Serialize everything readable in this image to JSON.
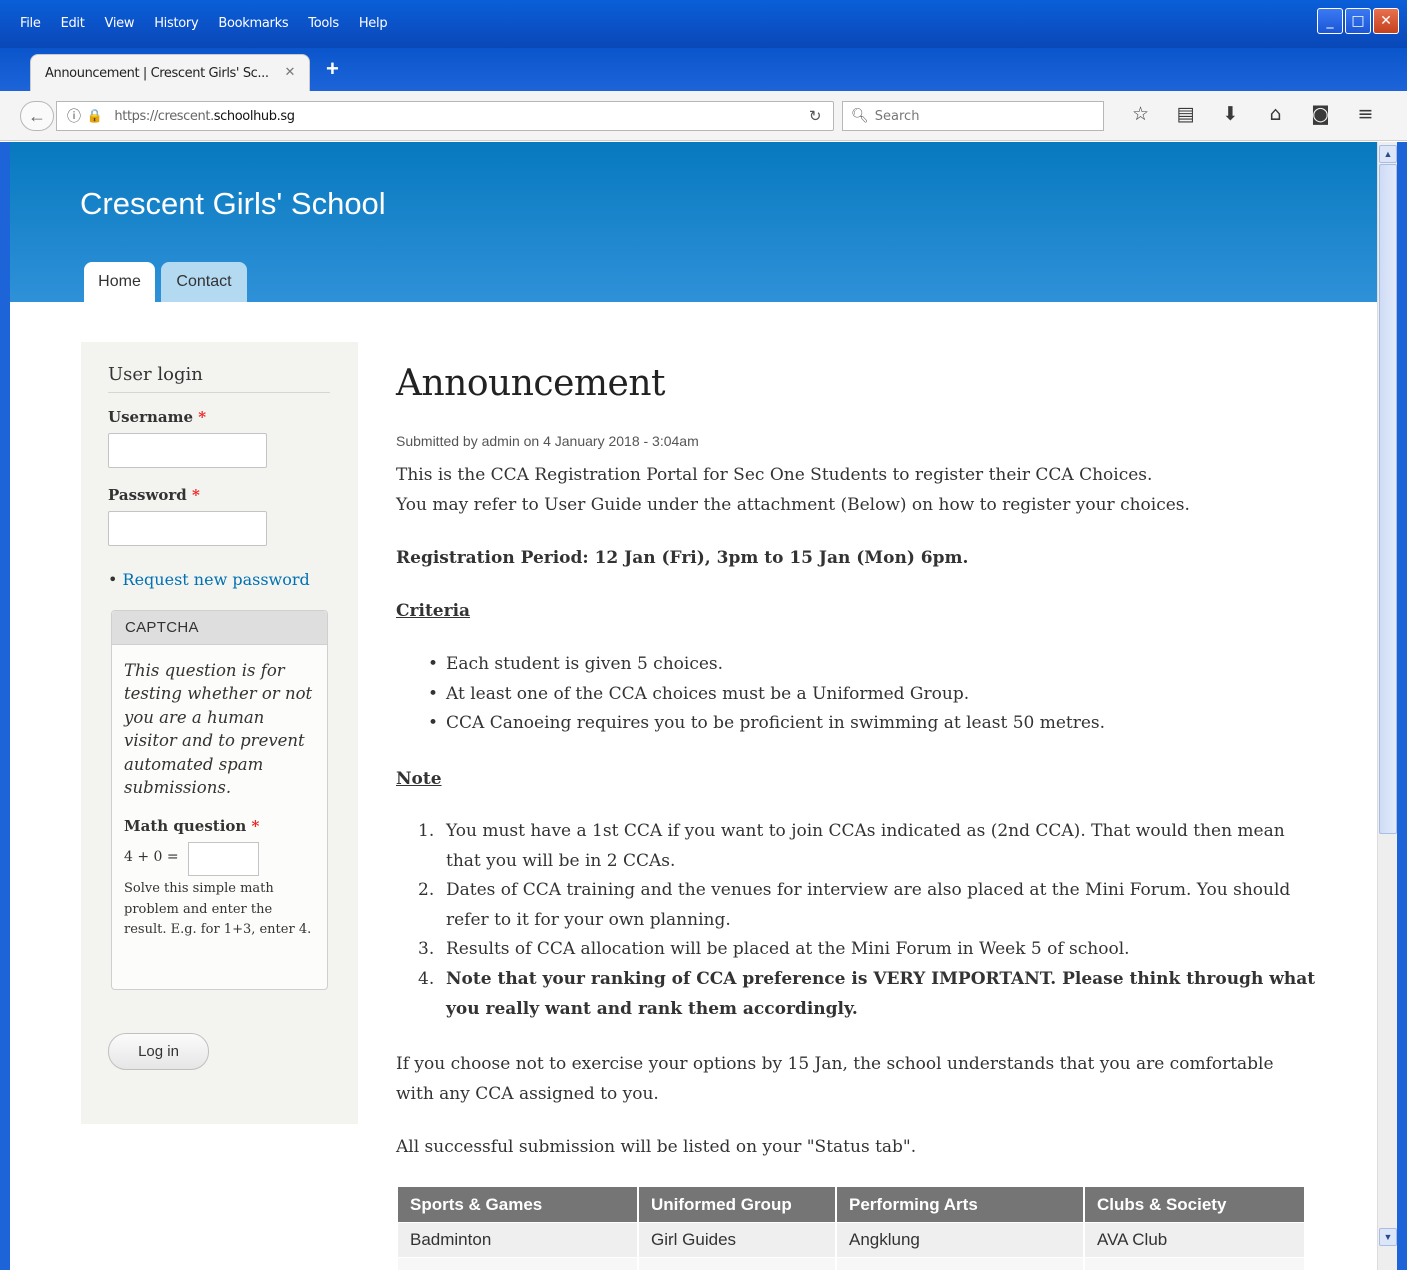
{
  "browser": {
    "menu": [
      "File",
      "Edit",
      "View",
      "History",
      "Bookmarks",
      "Tools",
      "Help"
    ],
    "tab_title": "Announcement | Crescent Girls' Sc...",
    "tab_close": "✕",
    "new_tab": "+",
    "url_prefix": "https://crescent.",
    "url_domain": "schoolhub.sg",
    "search_placeholder": "Search",
    "window_buttons": [
      "_",
      "□",
      "✕"
    ]
  },
  "site": {
    "name": "Crescent Girls' School",
    "tabs": [
      {
        "label": "Home"
      },
      {
        "label": "Contact"
      }
    ]
  },
  "login": {
    "title": "User login",
    "username_label": "Username",
    "password_label": "Password",
    "required_mark": "*",
    "bullet": "•",
    "request_password": "Request new password",
    "captcha_legend": "CAPTCHA",
    "captcha_desc": "This question is for testing whether or not you are a human visitor and to prevent automated spam submissions.",
    "math_label": "Math question",
    "math_expr": "4 + 0 =",
    "math_help": "Solve this simple math problem and enter the result. E.g. for 1+3, enter 4.",
    "login_button": "Log in"
  },
  "article": {
    "title": "Announcement",
    "submitted": "Submitted by admin on 4 January 2018 - 3:04am",
    "intro_1": "This is the CCA Registration Portal for Sec One Students to register their CCA Choices.",
    "intro_2": "You may refer to User Guide under the attachment (Below) on how to register your choices.",
    "registration_period": "Registration Period: 12 Jan (Fri), 3pm to 15 Jan (Mon) 6pm.",
    "criteria_heading": "Criteria",
    "criteria": [
      "Each student is given 5 choices.",
      "At least one of the CCA choices must be a Uniformed Group.",
      "CCA Canoeing requires you to be proficient in swimming at least 50 metres."
    ],
    "note_heading": "Note",
    "notes": [
      {
        "num": "1.",
        "text": "You must have a 1st CCA if you want to join CCAs indicated as (2nd CCA). That would then mean that you will be in 2 CCAs."
      },
      {
        "num": "2.",
        "text": "Dates of CCA training and the venues for interview are also placed at the Mini Forum. You should refer to it for your own planning."
      },
      {
        "num": "3.",
        "text": "Results of CCA allocation will be placed at the Mini Forum in Week 5 of school."
      },
      {
        "num": "4.",
        "text": "Note that your ranking of CCA preference is VERY IMPORTANT. Please think through what you really want and rank them accordingly."
      }
    ],
    "closing_1": "If you choose not to exercise your options by 15 Jan, the school understands that you are comfortable",
    "closing_2": "with any CCA assigned to you.",
    "status_line": "All successful submission will be listed on your \"Status tab\".",
    "table": {
      "headers": [
        "Sports & Games",
        "Uniformed Group",
        "Performing Arts",
        "Clubs & Society"
      ],
      "rows": [
        [
          "Badminton",
          "Girl Guides",
          "Angklung",
          "AVA Club"
        ]
      ]
    }
  }
}
